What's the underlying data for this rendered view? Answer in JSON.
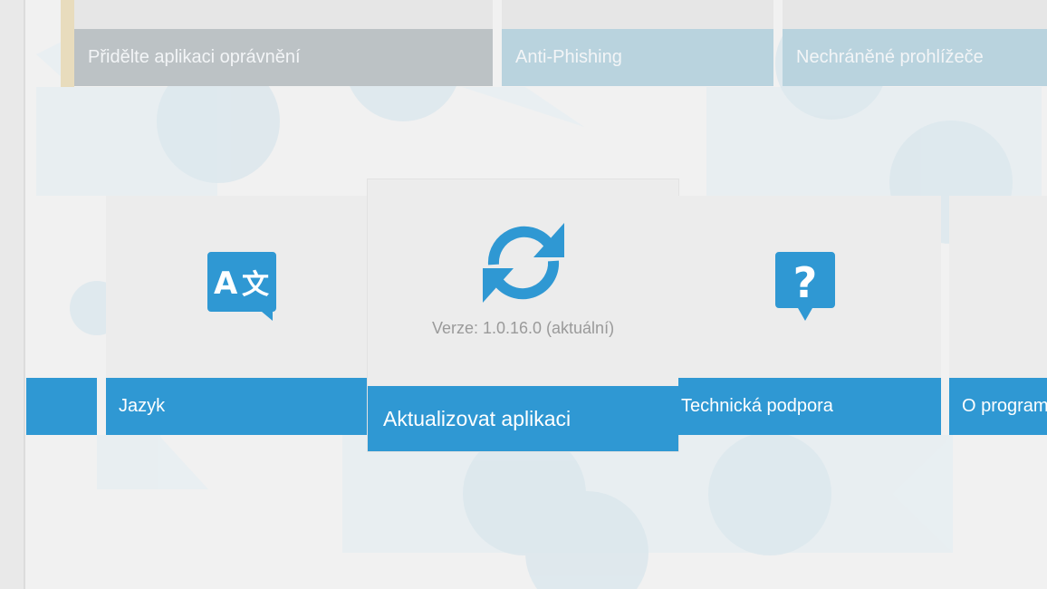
{
  "top_cards": [
    {
      "label": "Přidělte aplikaci oprávnění"
    },
    {
      "label": "Anti-Phishing"
    },
    {
      "label": "Nechráněné prohlížeče"
    }
  ],
  "tiles": {
    "language": {
      "label": "Jazyk",
      "icon": "translate-icon"
    },
    "update": {
      "label": "Aktualizovat aplikaci",
      "icon": "refresh-icon",
      "version": "Verze: 1.0.16.0 (aktuální)"
    },
    "support": {
      "label": "Technická podpora",
      "icon": "question-bubble-icon"
    },
    "about": {
      "label": "O program"
    }
  },
  "colors": {
    "accent": "#2f98d3",
    "tile_bg": "#ececec",
    "card_grey": "#bcc2c5",
    "card_blue": "#b9d3de"
  }
}
